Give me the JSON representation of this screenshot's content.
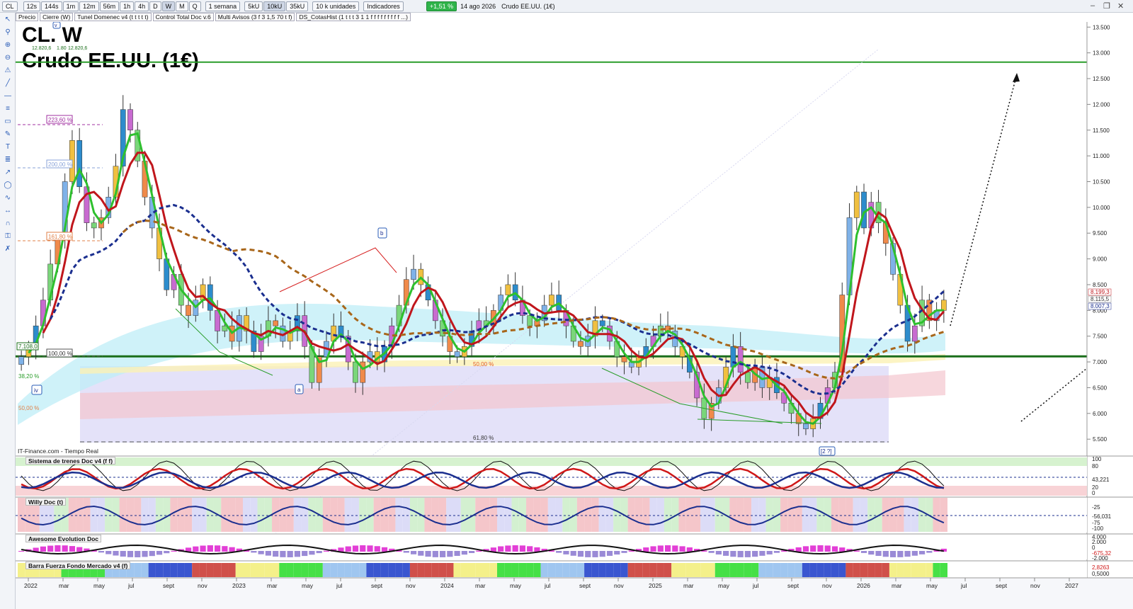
{
  "toolbar": {
    "symbol": "CL",
    "timeframes": [
      "12s",
      "144s",
      "1m",
      "12m",
      "56m",
      "1h",
      "4h",
      "D",
      "W",
      "M",
      "Q"
    ],
    "selected_timeframe": "W",
    "period": "1 semana",
    "units": [
      "5kU",
      "10kU",
      "35kU"
    ],
    "selected_unit": "10kU",
    "units_select": "10 k unidades",
    "indicators_label": "Indicadores",
    "change_pct": "+1,51 %",
    "date": "14 ago 2026",
    "instrument_name": "Crudo EE.UU. (1€)"
  },
  "indicator_strip": [
    "Precio",
    "Cierre (W)",
    "Tunel Domenec v4 (t t t t t)",
    "Control Total Doc v.6",
    "Multi Avisos (3 f 3 1,5 70 t f)",
    "DS_CotasHist (1 t t t 3 1 1 f f f f f f f f f ...)"
  ],
  "title": {
    "line1": "CL. W",
    "line2": "Crudo EE.UU. (1€)"
  },
  "source": "IT-Finance.com - Tiempo Real",
  "panels": {
    "p1": "Sistema de trenes Doc v4 (f f)",
    "p2": "Willy Doc (t)",
    "p3": "Awesome Evolution Doc",
    "p4": "Barra Fuerza Fondo Mercado v4 (f)"
  },
  "annotations": {
    "fib_223": "223,60 %",
    "fib_200": "200,00 %",
    "fib_161": "161,80 %",
    "fib_100": "100,00 %",
    "fib_38": "38,20 %",
    "fib_50_left": "50,00 %",
    "fib_50": "50,00 %",
    "fib_618": "61,80 %",
    "price_box": "7.108,0",
    "top_vals": [
      "12.820,6",
      "1.80",
      "12.820,6"
    ],
    "wave_iv": "iv",
    "wave_a": "a",
    "wave_b": "b",
    "wave_2": "[2 ?]",
    "wave_v": "v"
  },
  "right_labels": {
    "p1": [
      "100",
      "80",
      "43,221",
      "20",
      "0"
    ],
    "p2": [
      "-25",
      "-56,031",
      "-75",
      "-100"
    ],
    "p3": [
      "4.000",
      "2.000",
      "0",
      "-675,32",
      "-2.000"
    ],
    "p4": [
      "2,8263",
      "0,5000"
    ],
    "last_prices": [
      "8.199,3",
      "8.115,5",
      "8.007,3"
    ]
  },
  "chart_data": {
    "type": "candlestick",
    "title": "CL. W",
    "subtitle": "Crudo EE.UU. (1€)",
    "y_ticks": [
      5500,
      6000,
      6500,
      7000,
      7500,
      8000,
      8500,
      9000,
      9500,
      10000,
      10500,
      11000,
      11500,
      12000,
      12500,
      13000,
      13500
    ],
    "y_tick_labels": [
      "5.500",
      "6.000",
      "6.500",
      "7.000",
      "7.500",
      "8.000",
      "8.500",
      "9.000",
      "9.500",
      "10.000",
      "10.500",
      "11.000",
      "11.500",
      "12.000",
      "12.500",
      "13.000",
      "13.500"
    ],
    "ylim": [
      5200,
      13600
    ],
    "x_labels": [
      "2022",
      "mar",
      "may",
      "jul",
      "sept",
      "nov",
      "2023",
      "mar",
      "may",
      "jul",
      "sept",
      "nov",
      "2024",
      "mar",
      "may",
      "jul",
      "sept",
      "nov",
      "2025",
      "mar",
      "may",
      "jul",
      "sept",
      "nov",
      "2026",
      "mar",
      "may",
      "jul",
      "sept",
      "nov",
      "2027",
      "mar",
      "may"
    ],
    "horizontal_lines": [
      {
        "value": 12820,
        "color": "#2a9d2a"
      },
      {
        "value": 7108,
        "color": "#1a6e1a"
      }
    ],
    "close_series": [
      7100,
      7250,
      7700,
      8200,
      8900,
      9400,
      10500,
      11300,
      10400,
      9700,
      9600,
      9800,
      10200,
      10800,
      11900,
      11500,
      10900,
      10200,
      9600,
      9000,
      8400,
      8700,
      8100,
      7900,
      8200,
      8500,
      8000,
      7600,
      7700,
      7400,
      7900,
      7600,
      7200,
      7500,
      7800,
      7700,
      7400,
      7600,
      7900,
      7300,
      6600,
      7100,
      7400,
      7700,
      7500,
      7000,
      6600,
      7000,
      7200,
      7000,
      7300,
      7700,
      8100,
      8600,
      8800,
      8500,
      8200,
      7800,
      7500,
      7200,
      7100,
      7300,
      7600,
      7800,
      7700,
      8000,
      8300,
      8500,
      8200,
      7900,
      7700,
      7800,
      8100,
      8300,
      8000,
      7700,
      7400,
      7300,
      7500,
      7800,
      7700,
      7400,
      7100,
      7000,
      6900,
      7100,
      7300,
      7500,
      7700,
      7600,
      7300,
      7100,
      6800,
      6300,
      5900,
      6200,
      6500,
      6900,
      7300,
      6800,
      6600,
      6900,
      6500,
      6700,
      6400,
      6200,
      6000,
      5800,
      5700,
      5900,
      6200,
      6500,
      6800,
      8300,
      9800,
      10300,
      9600,
      10100,
      9700,
      9300,
      8700,
      8100,
      7400,
      7700,
      8200,
      7800,
      8000,
      8200
    ]
  }
}
